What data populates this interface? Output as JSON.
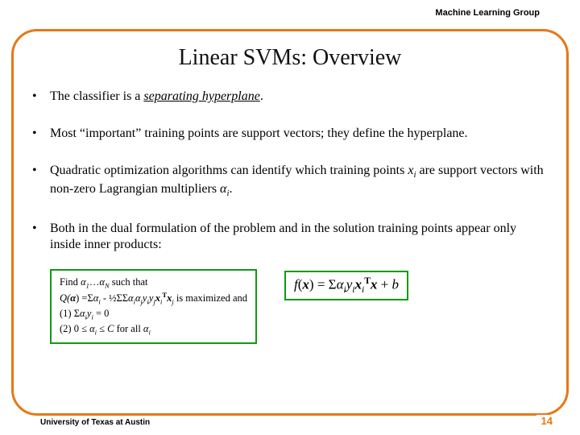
{
  "header": {
    "group": "Machine Learning Group"
  },
  "title": "Linear SVMs:  Overview",
  "bullets": [
    {
      "pre": "The classifier is a ",
      "em": "separating hyperplane",
      "post": "."
    },
    {
      "text": "Most “important” training points are support vectors; they define the hyperplane."
    },
    {
      "pre": "Quadratic optimization algorithms can identify which training points ",
      "xi": "x",
      "xi_sub": "i",
      "mid": " are support vectors with non-zero Lagrangian multipliers ",
      "ai": "α",
      "ai_sub": "i",
      "post": "."
    },
    {
      "text": "Both in the dual formulation of the problem and in the solution training points appear only inside inner products:"
    }
  ],
  "dualbox": {
    "l1a": "Find ",
    "l1b": "α",
    "l1c": "1",
    "l1d": "…",
    "l1e": "α",
    "l1f": "N",
    "l1g": " such that",
    "l2a": "Q(",
    "l2b": "α",
    "l2c": ") =Σ",
    "l2d": "α",
    "l2e": "i",
    "l2f": " - ½ΣΣ",
    "l2g": "α",
    "l2h": "i",
    "l2i": "α",
    "l2j": "j",
    "l2k": "y",
    "l2l": "i",
    "l2m": "y",
    "l2n": "j",
    "l2o": "x",
    "l2p": "i",
    "l2q": "T",
    "l2r": "x",
    "l2s": "j",
    "l2t": " is maximized and",
    "l3a": "(1)  Σ",
    "l3b": "α",
    "l3c": "i",
    "l3d": "y",
    "l3e": "i",
    "l3f": " = 0",
    "l4a": "(2)  0 ≤ ",
    "l4b": "α",
    "l4c": "i",
    "l4d": " ≤ ",
    "l4e": "C",
    "l4f": " for all ",
    "l4g": "α",
    "l4h": "i"
  },
  "fxbox": {
    "a": "f",
    "b": "(",
    "c": "x",
    "d": ") = Σ",
    "e": "α",
    "f": "i",
    "g": "y",
    "h": "i",
    "i": "x",
    "j": "i",
    "k": "T",
    "l": "x",
    "m": " + ",
    "n": "b"
  },
  "footer": {
    "left": "University of Texas at Austin",
    "page": "14"
  }
}
